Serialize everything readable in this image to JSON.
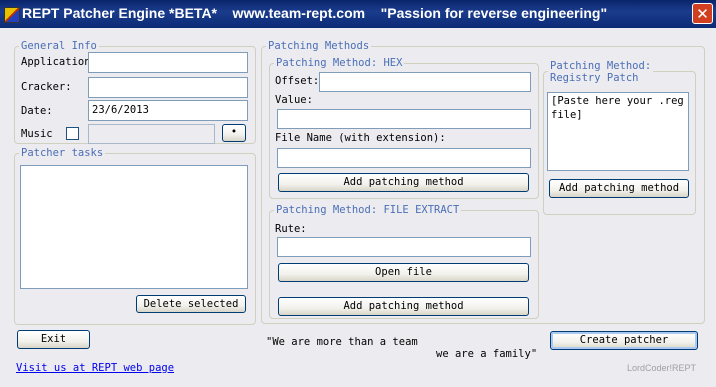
{
  "title": "REPT Patcher Engine *BETA*    www.team-rept.com    \"Passion for reverse engineering\"",
  "close_glyph": "✕",
  "general_info": {
    "legend": "General Info",
    "application_label": "Application",
    "application_value": "",
    "cracker_label": "Cracker:",
    "cracker_value": "",
    "date_label": "Date:",
    "date_value": "23/6/2013",
    "music_label": "Music",
    "music_path": "",
    "browse_label": "•"
  },
  "patcher_tasks": {
    "legend": "Patcher tasks",
    "items": [],
    "delete_label": "Delete selected"
  },
  "patching_methods": {
    "legend": "Patching Methods",
    "hex": {
      "legend": "Patching Method: HEX",
      "offset_label": "Offset:",
      "offset_value": "",
      "value_label": "Value:",
      "value_value": "",
      "filename_label": "File Name (with extension):",
      "filename_value": "",
      "add_label": "Add patching method"
    },
    "registry": {
      "legend": "Patching Method:\nRegistry Patch",
      "text": "[Paste here your .reg file]",
      "add_label": "Add patching method"
    },
    "file_extract": {
      "legend": "Patching Method: FILE EXTRACT",
      "route_label": "Rute:",
      "route_value": "",
      "open_label": "Open file",
      "add_label": "Add patching method"
    }
  },
  "footer": {
    "exit_label": "Exit",
    "create_label": "Create patcher",
    "quote_line1": "\"We are more than a team",
    "quote_line2": "we are a family\"",
    "link_text": "Visit us at REPT web page",
    "signature": "LordCoder!REPT"
  }
}
